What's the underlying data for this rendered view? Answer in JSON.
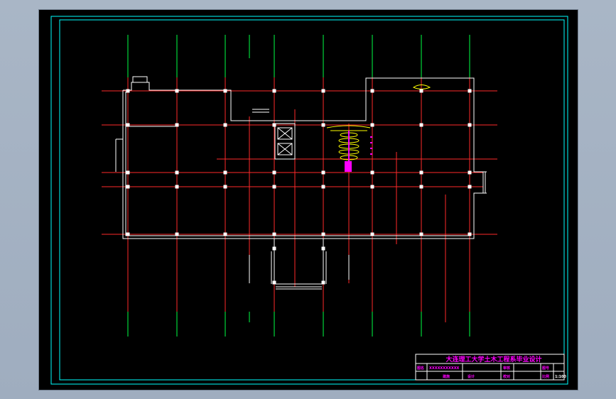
{
  "colors": {
    "background": "#000000",
    "border": "#00ffff",
    "axis": "#ff2a2a",
    "axis_ext": "#00ff44",
    "wall": "#ffffff",
    "column": "#ffffff",
    "title": "#ff00ff",
    "stair": "#ffff00"
  },
  "title_block": {
    "title": "大连理工大学土木工程系毕业设计",
    "cells": [
      "图名",
      "XXXXXXXXXXX",
      "审核",
      "图号",
      "建施",
      "比例",
      "1:100",
      "设计",
      "校对"
    ]
  }
}
